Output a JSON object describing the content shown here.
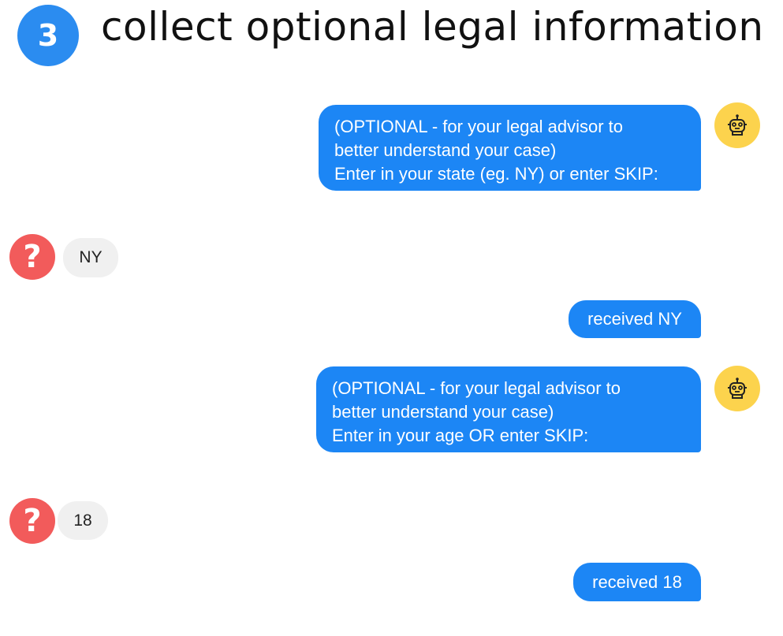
{
  "header": {
    "step_number": "3",
    "title": "collect optional legal information"
  },
  "messages": [
    {
      "from": "bot",
      "lines": [
        "(OPTIONAL - for your legal advisor to",
        "better understand your case)",
        "Enter in your state (eg. NY) or enter SKIP:"
      ],
      "avatar_icon": "robot-icon"
    },
    {
      "from": "user",
      "text": "NY",
      "avatar_icon": "question-mark-icon"
    },
    {
      "from": "bot",
      "text": "received NY"
    },
    {
      "from": "bot",
      "lines": [
        "(OPTIONAL - for your legal advisor to",
        "better understand your case)",
        "Enter in your age OR enter SKIP:"
      ],
      "avatar_icon": "robot-icon"
    },
    {
      "from": "user",
      "text": "18",
      "avatar_icon": "question-mark-icon"
    },
    {
      "from": "bot",
      "text": "received 18"
    }
  ],
  "colors": {
    "step_badge": "#2b8cf0",
    "bot_bubble": "#1c86f5",
    "user_bubble": "#f0f0f0",
    "bot_avatar": "#fcd34d",
    "user_avatar": "#f25b5b"
  }
}
